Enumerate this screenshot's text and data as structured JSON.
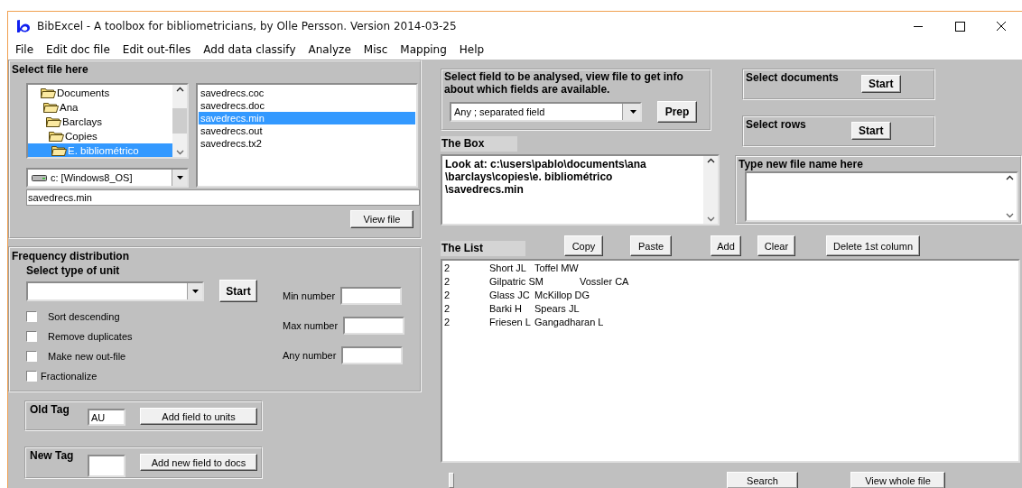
{
  "window": {
    "title": "BibExcel - A toolbox for bibliometricians, by Olle Persson. Version 2014-03-25"
  },
  "menu": [
    "File",
    "Edit doc file",
    "Edit out-files",
    "Add data classify",
    "Analyze",
    "Misc",
    "Mapping",
    "Help"
  ],
  "file_panel": {
    "title": "Select file here",
    "folders": [
      {
        "label": "Documents",
        "selected": false,
        "children": [
          {
            "label": "Ana",
            "selected": false,
            "children": [
              {
                "label": "Barclays",
                "selected": false,
                "children": [
                  {
                    "label": "Copies",
                    "selected": false,
                    "children": [
                      {
                        "label": "E. bibliométrico",
                        "selected": true
                      }
                    ]
                  }
                ]
              }
            ]
          }
        ]
      }
    ],
    "files": [
      {
        "label": "savedrecs.coc",
        "selected": false
      },
      {
        "label": "savedrecs.doc",
        "selected": false
      },
      {
        "label": "savedrecs.min",
        "selected": true
      },
      {
        "label": "savedrecs.out",
        "selected": false
      },
      {
        "label": "savedrecs.tx2",
        "selected": false
      }
    ],
    "drive": "c: [Windows8_OS]",
    "filename": "savedrecs.min",
    "view_button": "View file"
  },
  "frequency": {
    "title": "Frequency distribution",
    "subtitle": "Select type of unit",
    "start_button": "Start",
    "options": [
      {
        "label": "Sort descending",
        "checked": false
      },
      {
        "label": "Remove duplicates",
        "checked": false
      },
      {
        "label": "Make new out-file",
        "checked": false
      },
      {
        "label": "Fractionalize",
        "checked": false
      }
    ],
    "numbers": [
      {
        "label": "Min number"
      },
      {
        "label": "Max number"
      },
      {
        "label": "Any number"
      }
    ]
  },
  "old_tag": {
    "label": "Old Tag",
    "value": "AU",
    "button": "Add field to units"
  },
  "new_tag": {
    "label": "New Tag",
    "button": "Add new field to docs"
  },
  "field_select": {
    "title": "Select field to be analysed, view file to get info about which fields are available.",
    "value": "Any ; separated field",
    "button": "Prep"
  },
  "select_documents": {
    "label": "Select documents",
    "button": "Start"
  },
  "select_rows": {
    "label": "Select rows",
    "button": "Start"
  },
  "the_box": {
    "label": "The Box",
    "lines": [
      "Look at: c:\\users\\pablo\\documents\\ana",
      "\\barclays\\copies\\e. bibliométrico",
      "\\savedrecs.min"
    ]
  },
  "new_file": {
    "label": "Type new file name here"
  },
  "the_list": {
    "label": "The List",
    "buttons": [
      "Copy",
      "Paste",
      "Add",
      "Clear",
      "Delete 1st column"
    ],
    "rows": [
      "2\tShort JL\tToffel MW",
      "2\tGilpatric SM\tVossler CA",
      "2\tGlass JC\tMcKillop DG",
      "2\tBarki H\tSpears JL",
      "2\tFriesen L\tGangadharan L"
    ]
  },
  "bottom": {
    "buttons": [
      "Search",
      "View whole file"
    ]
  }
}
